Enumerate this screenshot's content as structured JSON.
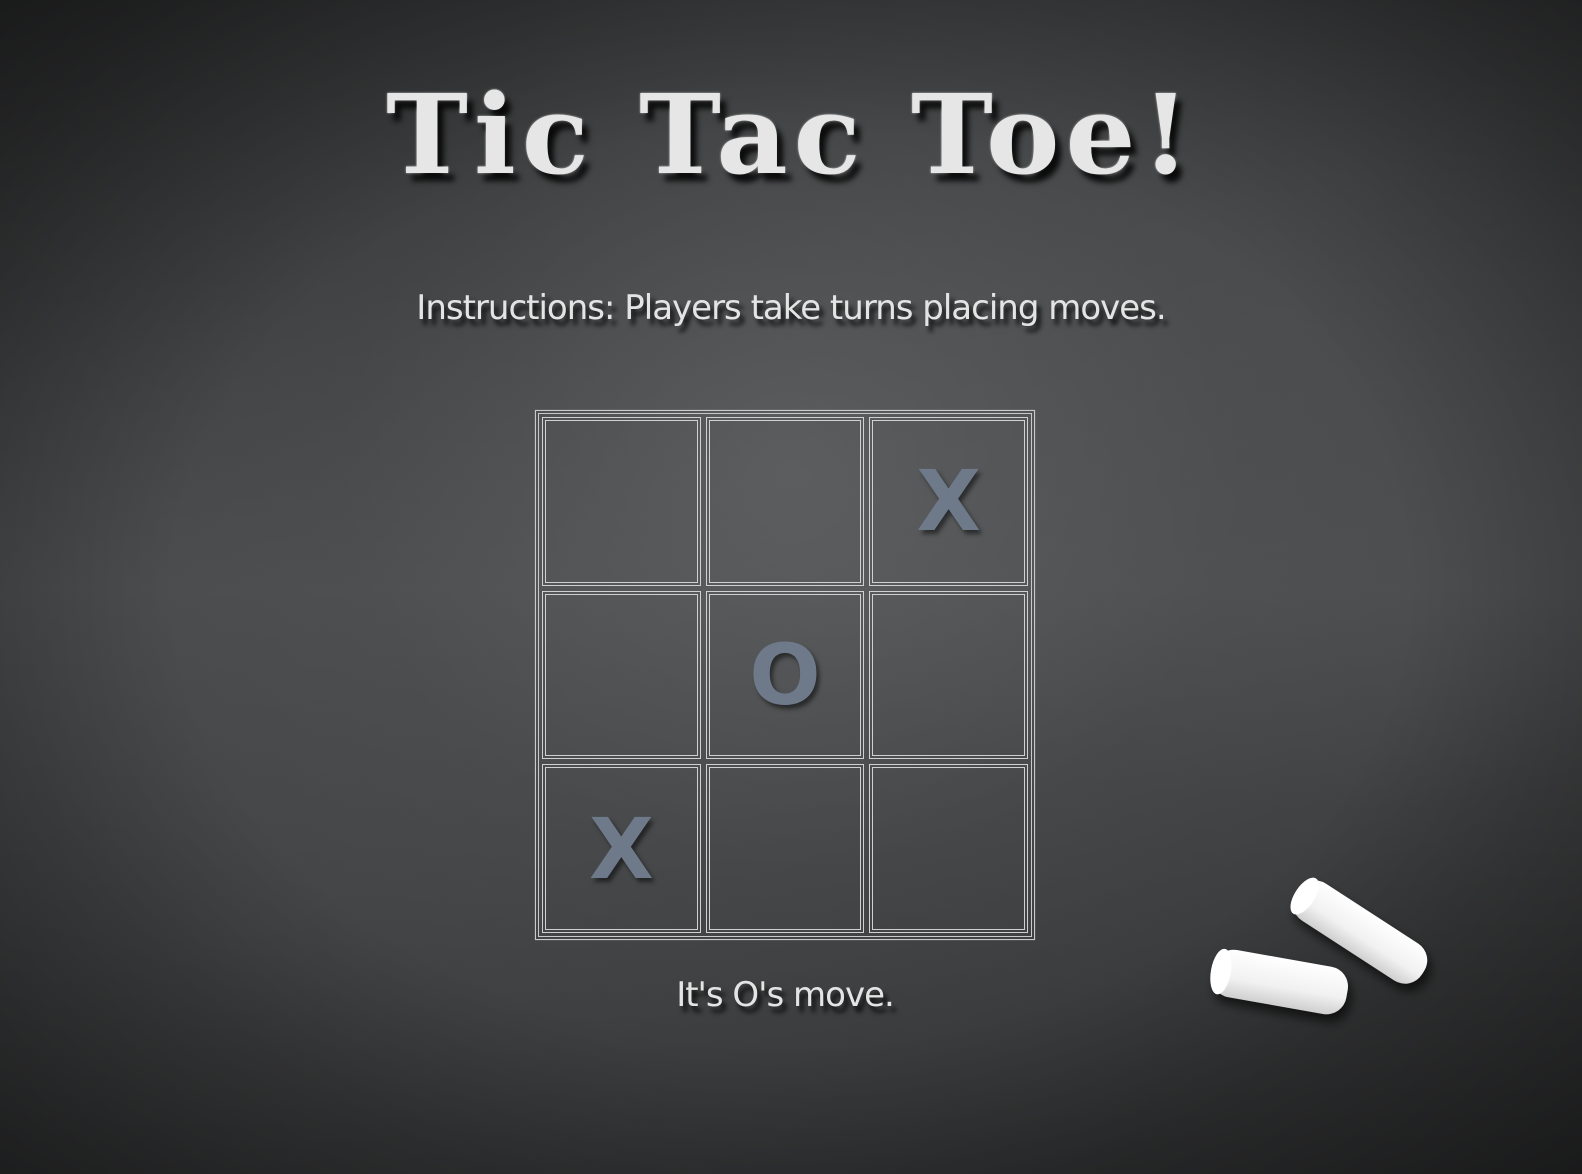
{
  "game": {
    "title": "Tic Tac Toe!",
    "instructions": "Instructions: Players take turns placing moves.",
    "status": "It's O's move.",
    "board": [
      "",
      "",
      "X",
      "",
      "O",
      "",
      "X",
      "",
      ""
    ]
  },
  "colors": {
    "chalkboard": "#3e3f40",
    "chalk_text": "#e4e4e4",
    "mark": "#6e7a8a",
    "grid_lines": "#d0d0d0"
  },
  "icons": {
    "chalk": "chalk-sticks-icon"
  }
}
